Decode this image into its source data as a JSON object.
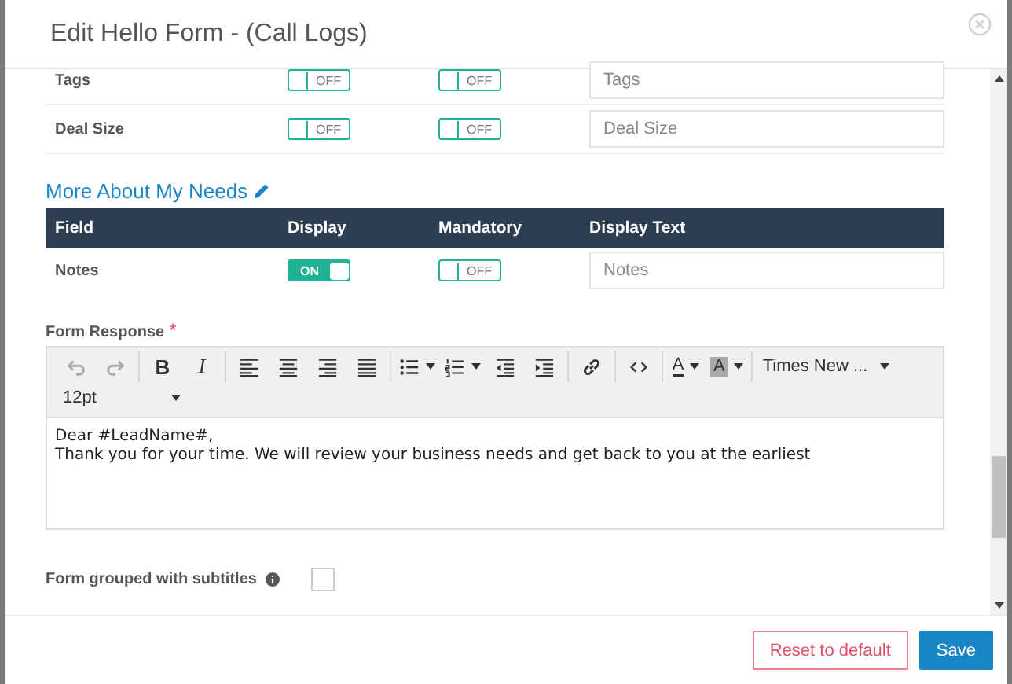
{
  "modal": {
    "title": "Edit Hello Form - (Call Logs)"
  },
  "top_rows": [
    {
      "field": "Tags",
      "display": {
        "on": false,
        "label": "OFF"
      },
      "mandatory": {
        "on": false,
        "label": "OFF"
      },
      "placeholder": "Tags"
    },
    {
      "field": "Deal Size",
      "display": {
        "on": false,
        "label": "OFF"
      },
      "mandatory": {
        "on": false,
        "label": "OFF"
      },
      "placeholder": "Deal Size"
    }
  ],
  "section": {
    "title": "More About My Needs",
    "columns": [
      "Field",
      "Display",
      "Mandatory",
      "Display Text"
    ],
    "rows": [
      {
        "field": "Notes",
        "display": {
          "on": true,
          "label": "ON"
        },
        "mandatory": {
          "on": false,
          "label": "OFF"
        },
        "placeholder": "Notes"
      }
    ]
  },
  "form_response": {
    "label": "Form Response",
    "required_mark": "*",
    "toolbar": [
      [
        {
          "kind": "undo",
          "disabled": true,
          "has_menu": false
        },
        {
          "kind": "redo",
          "disabled": true,
          "has_menu": false
        }
      ],
      [
        {
          "kind": "bold",
          "glyph": "B",
          "disabled": false,
          "has_menu": false
        },
        {
          "kind": "italic",
          "glyph": "I",
          "disabled": false,
          "has_menu": false
        }
      ],
      [
        {
          "kind": "align-left",
          "disabled": false,
          "has_menu": false
        },
        {
          "kind": "align-center",
          "disabled": false,
          "has_menu": false
        },
        {
          "kind": "align-right",
          "disabled": false,
          "has_menu": false
        },
        {
          "kind": "justify",
          "disabled": false,
          "has_menu": false
        }
      ],
      [
        {
          "kind": "bullets",
          "disabled": false,
          "has_menu": true
        },
        {
          "kind": "numbers",
          "disabled": false,
          "has_menu": true
        },
        {
          "kind": "outdent",
          "disabled": false,
          "has_menu": false
        },
        {
          "kind": "indent",
          "disabled": false,
          "has_menu": false
        }
      ],
      [
        {
          "kind": "link",
          "disabled": false,
          "has_menu": false
        }
      ],
      [
        {
          "kind": "code",
          "disabled": false,
          "has_menu": false
        }
      ],
      [
        {
          "kind": "text-color",
          "glyph": "A",
          "disabled": false,
          "has_menu": true
        },
        {
          "kind": "highlight",
          "glyph": "A",
          "disabled": false,
          "has_menu": true
        }
      ]
    ],
    "font_family": "Times New ...",
    "font_size": "12pt",
    "lines": [
      "Dear #LeadName#,",
      "Thank you for your time. We will review your business needs and get back to you at the earliest"
    ]
  },
  "grouped": {
    "label": "Form grouped with subtitles",
    "checked": false
  },
  "buttons": [
    {
      "label": "Reset to default",
      "kind": "secondary"
    },
    {
      "label": "Save",
      "kind": "primary"
    }
  ]
}
